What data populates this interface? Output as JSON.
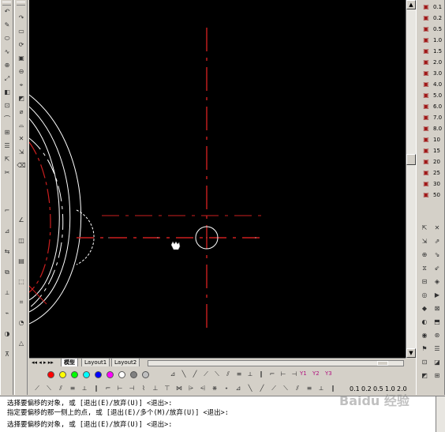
{
  "left_toolbar_icons": [
    "↶",
    "↷",
    "✎",
    "▭",
    "⬭",
    "⟳",
    "∿",
    "▣",
    "⊕",
    "⊖",
    "⤢",
    "⌖",
    "◧",
    "◩",
    "⊡",
    "⌀",
    "⌒",
    "⌓",
    "⊞",
    "✕",
    "☰",
    "⇲",
    "⇱",
    "⌫",
    "✂"
  ],
  "left_lower_icons": [
    "⌐",
    "∠",
    "⊿",
    "◫",
    "⇆",
    "▤",
    "⧉",
    "⬚",
    "⟂",
    "⌗",
    "⌁",
    "◔",
    "◑",
    "△",
    "⊼"
  ],
  "layout_tabs": {
    "model": "模型",
    "layout1": "Layout1",
    "layout2": "Layout2"
  },
  "colors": {
    "canvas": "#000000",
    "geometry_white": "#ffffff",
    "centerline_red": "#cc1f1f",
    "swatches": [
      "#ff0000",
      "#ffff00",
      "#00ff00",
      "#00ffff",
      "#0000ff",
      "#ff00ff",
      "#ffffff",
      "#808080",
      "#c0c0c0"
    ]
  },
  "bottom_toolbar_labels": [
    "Y1",
    "Y2",
    "Y3"
  ],
  "lineweights": [
    "0.1",
    "0.2",
    "0.5",
    "1.0",
    "2.0"
  ],
  "right_scale_labels": [
    "0.1",
    "0.2",
    "0.5",
    "1.0",
    "1.5",
    "2.0",
    "3.0",
    "4.0",
    "5.0",
    "6.0",
    "7.0",
    "8.0",
    "10",
    "15",
    "20",
    "25",
    "30",
    "50"
  ],
  "command_lines": [
    "选择要偏移的对象, 或 [退出(E)/放弃(U)] <退出>:",
    "指定要偏移的那一侧上的点, 或 [退出(E)/多个(M)/放弃(U)] <退出>:",
    "选择要偏移的对象, 或 [退出(E)/放弃(U)] <退出>:"
  ],
  "watermark": "Baidu 经验"
}
